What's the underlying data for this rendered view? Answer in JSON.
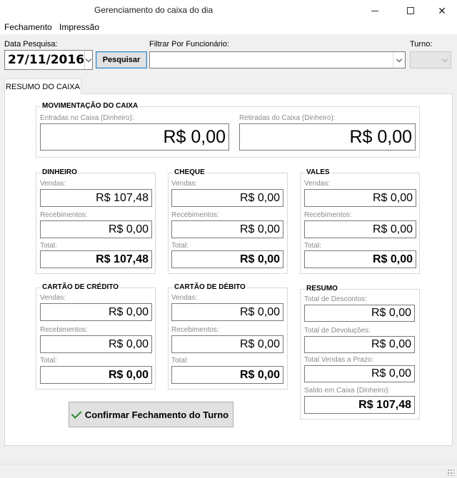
{
  "window": {
    "title": "Gerenciamento do caixa do dia"
  },
  "menu": [
    "Fechamento",
    "Impressão"
  ],
  "filters": {
    "date_label": "Data Pesquisa:",
    "date_value": "27/11/2016",
    "search_button": "Pesquisar",
    "employee_label": "Filtrar Por Funcionário:",
    "employee_value": "",
    "shift_label": "Turno:",
    "shift_value": ""
  },
  "tab": "RESUMO DO CAIXA",
  "movimentacao": {
    "title": "MOVIMENTAÇÃO DO CAIXA",
    "entradas_label": "Entradas no Caixa (Dinheiro):",
    "entradas_value": "R$ 0,00",
    "retiradas_label": "Retiradas do Caixa (Dinheiro):",
    "retiradas_value": "R$ 0,00"
  },
  "dinheiro": {
    "title": "DINHEIRO",
    "vendas_label": "Vendas:",
    "vendas": "R$ 107,48",
    "receb_label": "Recebimentos:",
    "receb": "R$ 0,00",
    "total_label": "Total:",
    "total": "R$ 107,48"
  },
  "cheque": {
    "title": "CHEQUE",
    "vendas_label": "Vendas:",
    "vendas": "R$ 0,00",
    "receb_label": "Recebimentos:",
    "receb": "R$ 0,00",
    "total_label": "Total:",
    "total": "R$ 0,00"
  },
  "vales": {
    "title": "VALES",
    "vendas_label": "Vendas:",
    "vendas": "R$ 0,00",
    "receb_label": "Recebimentos:",
    "receb": "R$ 0,00",
    "total_label": "Total:",
    "total": "R$ 0,00"
  },
  "credito": {
    "title": "CARTÃO DE CRÉDITO",
    "vendas_label": "Vendas:",
    "vendas": "R$ 0,00",
    "receb_label": "Recebimentos:",
    "receb": "R$ 0,00",
    "total_label": "Total:",
    "total": "R$ 0,00"
  },
  "debito": {
    "title": "CARTÃO DE DÉBITO",
    "vendas_label": "Vendas:",
    "vendas": "R$ 0,00",
    "receb_label": "Recebimentos:",
    "receb": "R$ 0,00",
    "total_label": "Total:",
    "total": "R$ 0,00"
  },
  "resumo": {
    "title": "RESUMO",
    "descontos_label": "Total de Descontos:",
    "descontos": "R$ 0,00",
    "devolucoes_label": "Total de Devoluções:",
    "devolucoes": "R$ 0,00",
    "prazo_label": "Total Vendas a Prazo:",
    "prazo": "R$ 0,00",
    "saldo_label": "Saldo em Caixa (Dinheiro):",
    "saldo": "R$ 107,48"
  },
  "confirm_button": "Confirmar Fechamento do Turno",
  "icons": {
    "confirm": "check-icon",
    "color_check": "#2d8c2d"
  }
}
